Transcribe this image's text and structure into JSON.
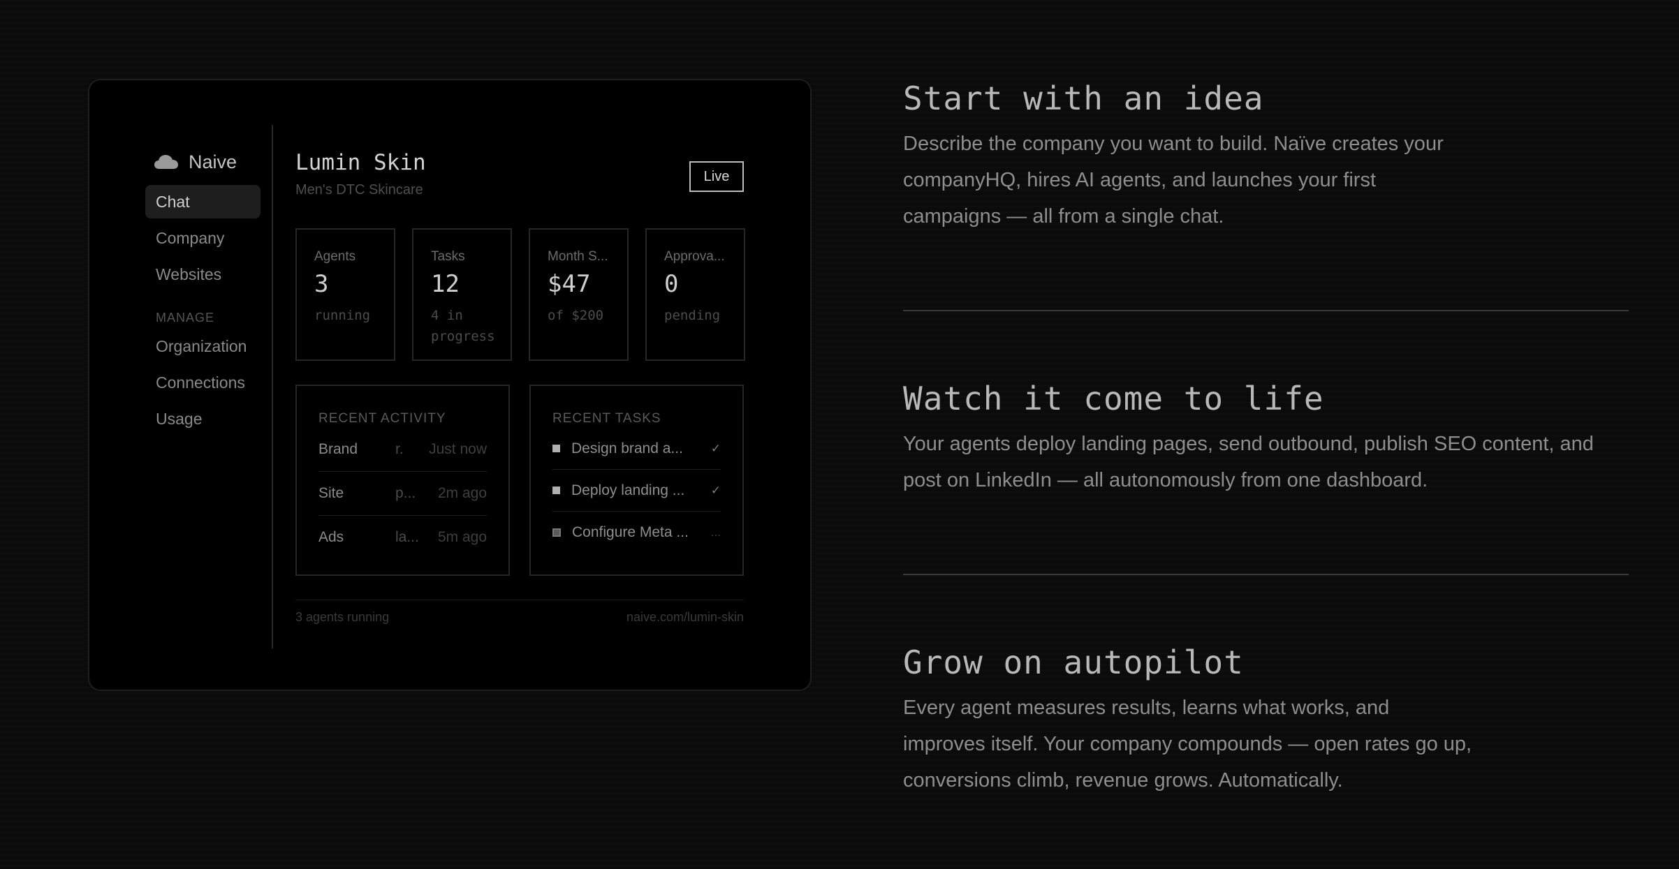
{
  "sidebar": {
    "brand": "Naive",
    "nav": [
      "Chat",
      "Company",
      "Websites"
    ],
    "section": "MANAGE",
    "manage": [
      "Organization",
      "Connections",
      "Usage"
    ]
  },
  "company": {
    "name": "Lumin Skin",
    "tagline": "Men's DTC Skincare",
    "status": "Live"
  },
  "stats": [
    {
      "label": "Agents",
      "value": "3",
      "sub": "running"
    },
    {
      "label": "Tasks",
      "value": "12",
      "sub": "4 in progress"
    },
    {
      "label": "Month S...",
      "value": "$47",
      "sub": "of $200"
    },
    {
      "label": "Approva...",
      "value": "0",
      "sub": "pending"
    }
  ],
  "activity": {
    "heading": "RECENT ACTIVITY",
    "items": [
      {
        "name": "Brand",
        "detail": "r.",
        "time": "Just now"
      },
      {
        "name": "Site",
        "detail": "p...",
        "time": "2m ago"
      },
      {
        "name": "Ads",
        "detail": "la...",
        "time": "5m ago"
      }
    ]
  },
  "tasks": {
    "heading": "RECENT TASKS",
    "items": [
      {
        "name": "Design brand a...",
        "status": "✓"
      },
      {
        "name": "Deploy landing ...",
        "status": "✓"
      },
      {
        "name": "Configure Meta ...",
        "status": "..."
      }
    ]
  },
  "footer": {
    "left": "3 agents running",
    "right": "naive.com/lumin-skin"
  },
  "features": [
    {
      "title": "Start with an idea",
      "desc": "Describe the company you want to build. Naïve creates your companyHQ, hires AI agents, and launches your first campaigns — all from a single chat."
    },
    {
      "title": "Watch it come to life",
      "desc": "Your agents deploy landing pages, send outbound, publish SEO content, and post on LinkedIn — all autonomously from one dashboard."
    },
    {
      "title": "Grow on autopilot",
      "desc": "Every agent measures results, learns what works, and improves itself. Your company compounds — open rates go up, conversions climb, revenue grows. Automatically."
    }
  ]
}
